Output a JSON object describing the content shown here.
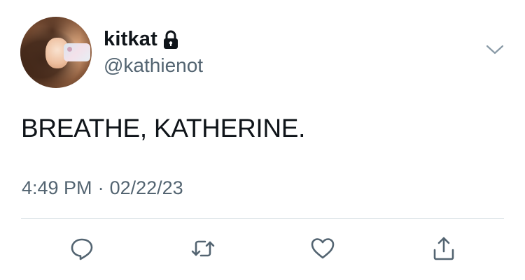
{
  "user": {
    "display_name": "kitkat",
    "handle": "@kathienot",
    "protected": true
  },
  "tweet": {
    "text": "BREATHE, KATHERINE.",
    "time": "4:49 PM",
    "separator": "·",
    "date": "02/22/23"
  },
  "icons": {
    "lock": "lock-icon",
    "more": "chevron-down-icon",
    "reply": "reply-icon",
    "retweet": "retweet-icon",
    "like": "heart-icon",
    "share": "share-icon"
  },
  "colors": {
    "text": "#0f1419",
    "secondary": "#536471",
    "divider": "#cfd9de",
    "icon": "#536471",
    "background": "#ffffff"
  }
}
